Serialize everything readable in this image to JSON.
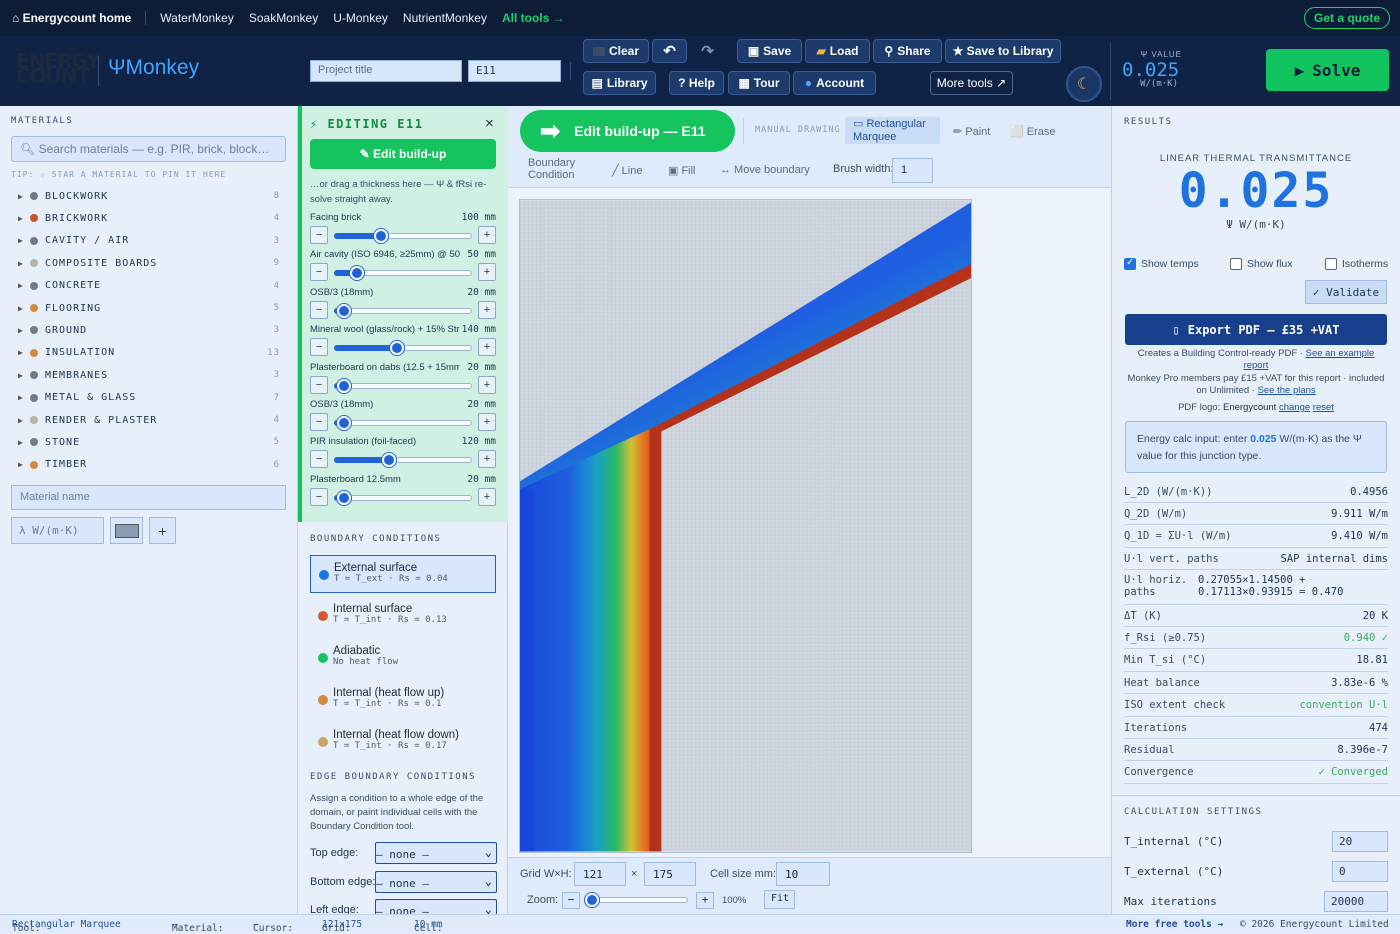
{
  "topnav": {
    "brand": "⌂ Energycount home",
    "links": [
      "WaterMonkey",
      "SoakMonkey",
      "U-Monkey",
      "NutrientMonkey"
    ],
    "all_tools": "All tools →",
    "quote": "Get a quote"
  },
  "header": {
    "logo_line1": "ENERGY",
    "logo_line2": "COUNT",
    "product": "ΨMonkey",
    "project_placeholder": "Project title",
    "junction_value": "E11",
    "buttons": {
      "clear": "Clear",
      "undo": "↶",
      "redo": "↷",
      "save": "Save",
      "load": "Load",
      "share": "Share",
      "save_library": "★ Save to Library",
      "library": "Library",
      "help": "? Help",
      "tour": "Tour",
      "account": "Account",
      "more_tools": "More tools ↗"
    },
    "psi_label": "Ψ VALUE",
    "psi_value": "0.025",
    "psi_unit": "W/(m·K)",
    "solve": "Solve"
  },
  "materials": {
    "title": "MATERIALS",
    "search_placeholder": "Search materials — e.g. PIR, brick, block…",
    "tip": "TIP: ☆ STAR A MATERIAL TO PIN IT HERE",
    "categories": [
      {
        "name": "BLOCKWORK",
        "count": "8",
        "color": "#6f7a8c"
      },
      {
        "name": "BRICKWORK",
        "count": "4",
        "color": "#c8542a"
      },
      {
        "name": "CAVITY / AIR",
        "count": "3",
        "color": "#6f7a8c"
      },
      {
        "name": "COMPOSITE BOARDS",
        "count": "9",
        "color": "#b7b2a6"
      },
      {
        "name": "CONCRETE",
        "count": "4",
        "color": "#6f7a8c"
      },
      {
        "name": "FLOORING",
        "count": "5",
        "color": "#d48a3c"
      },
      {
        "name": "GROUND",
        "count": "3",
        "color": "#6f7a8c"
      },
      {
        "name": "INSULATION",
        "count": "13",
        "color": "#d48a3c"
      },
      {
        "name": "MEMBRANES",
        "count": "3",
        "color": "#6f7a8c"
      },
      {
        "name": "METAL & GLASS",
        "count": "7",
        "color": "#6f7a8c"
      },
      {
        "name": "RENDER & PLASTER",
        "count": "4",
        "color": "#b7b2a6"
      },
      {
        "name": "STONE",
        "count": "5",
        "color": "#6f7a8c"
      },
      {
        "name": "TIMBER",
        "count": "6",
        "color": "#d48a3c"
      }
    ],
    "material_name_placeholder": "Material name",
    "lambda_placeholder": "λ W/(m·K)",
    "add": "+"
  },
  "editing": {
    "title": "⚡ EDITING E11",
    "close": "×",
    "edit_button": "✎ Edit build-up",
    "hint": "…or drag a thickness here — Ψ & fRsi re-solve straight away.",
    "layers": [
      {
        "name": "Facing brick",
        "value": "100",
        "unit": "mm",
        "fraction": 0.34
      },
      {
        "name": "Air cavity (ISO 6946, ≥25mm) @ 50 …",
        "value": "50",
        "unit": "mm",
        "fraction": 0.17
      },
      {
        "name": "OSB/3 (18mm)",
        "value": "20",
        "unit": "mm",
        "fraction": 0.07
      },
      {
        "name": "Mineral wool (glass/rock) + 15% Stru…",
        "value": "140",
        "unit": "mm",
        "fraction": 0.46
      },
      {
        "name": "Plasterboard on dabs (12.5 + 15mm)",
        "value": "20",
        "unit": "mm",
        "fraction": 0.07
      },
      {
        "name": "OSB/3 (18mm)",
        "value": "20",
        "unit": "mm",
        "fraction": 0.07
      },
      {
        "name": "PIR insulation (foil-faced)",
        "value": "120",
        "unit": "mm",
        "fraction": 0.4
      },
      {
        "name": "Plasterboard 12.5mm",
        "value": "20",
        "unit": "mm",
        "fraction": 0.07
      }
    ]
  },
  "boundary": {
    "title": "BOUNDARY CONDITIONS",
    "items": [
      {
        "name": "External surface",
        "formula": "T = T_ext · Rs = 0.04",
        "color": "#1e73e0"
      },
      {
        "name": "Internal surface",
        "formula": "T = T_int · Rs = 0.13",
        "color": "#d4582a"
      },
      {
        "name": "Adiabatic",
        "formula": "No heat flow",
        "color": "#15c45e"
      },
      {
        "name": "Internal (heat flow up)",
        "formula": "T = T_int · Rs = 0.1",
        "color": "#d48a3c"
      },
      {
        "name": "Internal (heat flow down)",
        "formula": "T = T_int · Rs = 0.17",
        "color": "#c9a56a"
      }
    ],
    "edge_title": "EDGE BOUNDARY CONDITIONS",
    "edge_text": "Assign a condition to a whole edge of the domain, or paint individual cells with the Boundary Condition tool.",
    "edges": [
      {
        "label": "Top edge:",
        "value": "– none –"
      },
      {
        "label": "Bottom edge:",
        "value": "– none –"
      },
      {
        "label": "Left edge:",
        "value": "– none –"
      }
    ]
  },
  "drawing": {
    "edit_big": "Edit build-up — E11",
    "manual": "MANUAL DRAWING",
    "tools": {
      "marquee": "▭ Rectangular Marquee",
      "paint": "✏ Paint",
      "erase": "⬜ Erase",
      "boundary": "Boundary Condition",
      "line": "╱ Line",
      "fill": "▣ Fill",
      "move": "↔ Move boundary"
    },
    "brush_label": "Brush width:",
    "brush_value": "1",
    "grid_label": "Grid W×H:",
    "grid_w": "121",
    "times": "×",
    "grid_h": "175",
    "cell_label": "Cell size mm:",
    "cell_value": "10",
    "zoom_label": "Zoom:",
    "zoom_value": "100%",
    "zoom_level": 0.0,
    "fit": "Fit",
    "minus": "−",
    "plus": "+"
  },
  "results": {
    "title": "RESULTS",
    "ltt": "LINEAR THERMAL TRANSMITTANCE",
    "value": "0.025",
    "unit": "Ψ W/(m·K)",
    "checks": [
      {
        "label": "Show temps",
        "on": true
      },
      {
        "label": "Show flux",
        "on": false
      },
      {
        "label": "Isotherms",
        "on": false
      }
    ],
    "validate": "✓ Validate",
    "export": "Export PDF — £35 +VAT",
    "note1": "Creates a Building Control-ready PDF · ",
    "note1_link": "See an example report",
    "note2": "Monkey Pro members pay £15 +VAT for this report · included on Unlimited · ",
    "note2_link": "See the plans",
    "logo_label": "PDF logo:",
    "logo_value": "Energycount",
    "logo_change": "change",
    "logo_reset": "reset",
    "energy_pre": "Energy calc input: enter ",
    "energy_val": "0.025",
    "energy_post": " W/(m·K) as the Ψ value for this junction type.",
    "rows": [
      {
        "k": "L_2D (W/(m·K))",
        "v": "0.4956"
      },
      {
        "k": "Q_2D (W/m)",
        "v": "9.911 W/m"
      },
      {
        "k": "Q_1D = ΣU·l (W/m)",
        "v": "9.410 W/m"
      },
      {
        "k": "U·l vert. paths",
        "v": "SAP internal dims"
      },
      {
        "k": "ΔT (K)",
        "v": "20 K"
      },
      {
        "k": "f_Rsi (≥0.75)",
        "v": "0.940 ✓",
        "good": true
      },
      {
        "k": "Min T_si (°C)",
        "v": "18.81"
      },
      {
        "k": "Heat balance",
        "v": "3.83e-6 %"
      },
      {
        "k": "ISO extent check",
        "v": "convention U·l",
        "good": true
      },
      {
        "k": "Iterations",
        "v": "474"
      },
      {
        "k": "Residual",
        "v": "8.396e-7"
      },
      {
        "k": "Convergence",
        "v": "✓ Converged",
        "good": true
      }
    ],
    "horiz_k": "U·l horiz. paths",
    "horiz_v1": "0.27055×1.14500 +",
    "horiz_v2": "0.17113×0.93915 = 0.470"
  },
  "calc": {
    "title": "CALCULATION SETTINGS",
    "rows": [
      {
        "k": "T_internal (°C)",
        "v": "20"
      },
      {
        "k": "T_external (°C)",
        "v": "0"
      },
      {
        "k": "Max iterations",
        "v": "20000"
      }
    ]
  },
  "status": {
    "tool_k": "Tool:",
    "tool_v": "Rectangular Marquee",
    "material_k": "Material:",
    "material_v": "—",
    "cursor_k": "Cursor:",
    "cursor_v": "—",
    "grid_k": "Grid:",
    "grid_v": "121×175",
    "cell_k": "Cell:",
    "cell_v": "10 mm",
    "more": "More free tools →",
    "copy": "© 2026 Energycount Limited"
  },
  "colors": {
    "accent": "#15c45e",
    "brand": "#102346",
    "blue": "#1e73e0"
  }
}
